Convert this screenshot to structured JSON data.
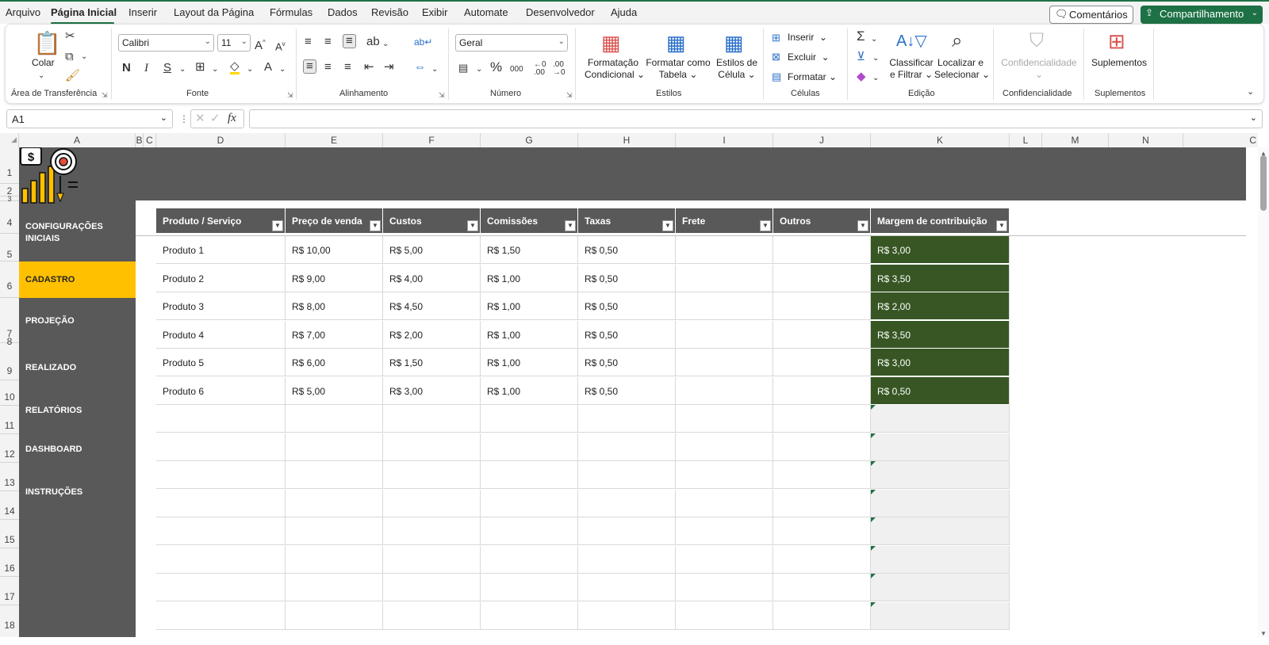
{
  "menu": {
    "items": [
      "Arquivo",
      "Página Inicial",
      "Inserir",
      "Layout da Página",
      "Fórmulas",
      "Dados",
      "Revisão",
      "Exibir",
      "Automate",
      "Desenvolvedor",
      "Ajuda"
    ],
    "comments": "Comentários",
    "share": "Compartilhamento"
  },
  "ribbon": {
    "clipboard": {
      "paste": "Colar",
      "label": "Área de Transferência"
    },
    "font": {
      "name": "Calibri",
      "size": "11",
      "label": "Fonte"
    },
    "alignment": {
      "label": "Alinhamento"
    },
    "number": {
      "format": "Geral",
      "label": "Número"
    },
    "styles": {
      "cond1": "Formatação",
      "cond2": "Condicional",
      "table1": "Formatar como",
      "table2": "Tabela",
      "cell1": "Estilos de",
      "cell2": "Célula",
      "label": "Estilos"
    },
    "cells": {
      "insert": "Inserir",
      "delete": "Excluir",
      "format": "Formatar",
      "label": "Células"
    },
    "editing": {
      "sort1": "Classificar",
      "sort2": "e Filtrar",
      "find1": "Localizar e",
      "find2": "Selecionar",
      "label": "Edição"
    },
    "sensitivity": {
      "button": "Confidencialidade",
      "label": "Confidencialidade"
    },
    "addins": {
      "button": "Suplementos",
      "label": "Suplementos"
    }
  },
  "formula_bar": {
    "name_box": "A1",
    "fx": "fx",
    "value": ""
  },
  "columns": [
    "A",
    "B",
    "C",
    "D",
    "E",
    "F",
    "G",
    "H",
    "I",
    "J",
    "K",
    "L",
    "M",
    "N"
  ],
  "rows": [
    "1",
    "2",
    "3",
    "4",
    "5",
    "6",
    "7",
    "8",
    "9",
    "10",
    "11",
    "12",
    "13",
    "14",
    "15",
    "16",
    "17",
    "18"
  ],
  "nav": [
    {
      "label": "CONFIGURAÇÕES",
      "label2": "INICIAIS",
      "active": false
    },
    {
      "label": "CADASTRO",
      "active": true
    },
    {
      "label": "PROJEÇÃO",
      "active": false
    },
    {
      "label": "REALIZADO",
      "active": false
    },
    {
      "label": "RELATÓRIOS",
      "active": false
    },
    {
      "label": "DASHBOARD",
      "active": false
    },
    {
      "label": "INSTRUÇÕES",
      "active": false
    }
  ],
  "table": {
    "headers": [
      "Produto / Serviço",
      "Preço de venda",
      "Custos",
      "Comissões",
      "Taxas",
      "Frete",
      "Outros",
      "Margem de contribuição"
    ],
    "rows": [
      [
        "Produto 1",
        "R$ 10,00",
        "R$ 5,00",
        "R$ 1,50",
        "R$ 0,50",
        "",
        "",
        "R$ 3,00"
      ],
      [
        "Produto 2",
        "R$ 9,00",
        "R$ 4,00",
        "R$ 1,00",
        "R$ 0,50",
        "",
        "",
        "R$ 3,50"
      ],
      [
        "Produto 3",
        "R$ 8,00",
        "R$ 4,50",
        "R$ 1,00",
        "R$ 0,50",
        "",
        "",
        "R$ 2,00"
      ],
      [
        "Produto 4",
        "R$ 7,00",
        "R$ 2,00",
        "R$ 1,00",
        "R$ 0,50",
        "",
        "",
        "R$ 3,50"
      ],
      [
        "Produto 5",
        "R$ 6,00",
        "R$ 1,50",
        "R$ 1,00",
        "R$ 0,50",
        "",
        "",
        "R$ 3,00"
      ],
      [
        "Produto 6",
        "R$ 5,00",
        "R$ 3,00",
        "R$ 1,00",
        "R$ 0,50",
        "",
        "",
        "R$ 0,50"
      ]
    ],
    "empty_rows": 8
  },
  "colors": {
    "band": "#595959",
    "active_nav": "#ffc000",
    "margin_fill": "#375623",
    "accent": "#1e7145"
  }
}
